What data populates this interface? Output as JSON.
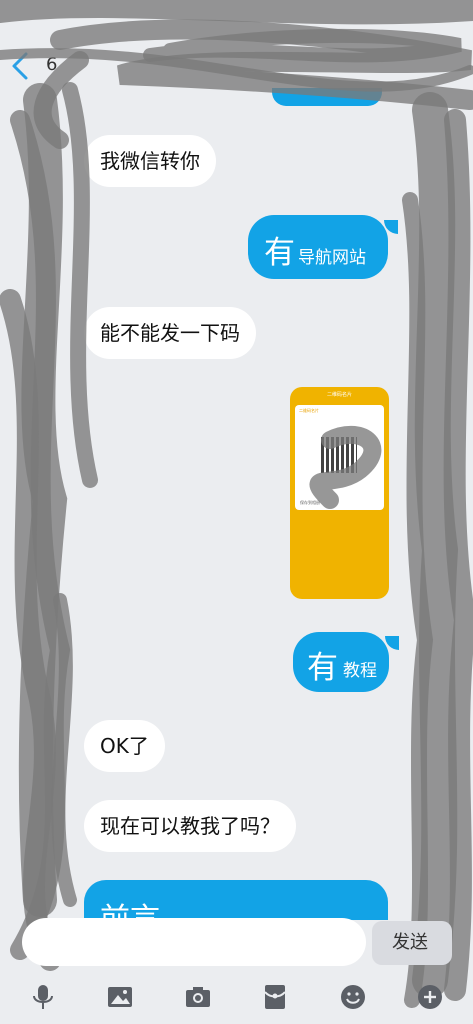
{
  "header": {
    "back_count": "6"
  },
  "messages": {
    "m1": "我微信转你",
    "m2_big": "有",
    "m2_small": "导航网站",
    "m3": "能不能发一下码",
    "m4_big": "有",
    "m4_small": "教程",
    "m5": "OK了",
    "m6": "现在可以教我了吗？",
    "m7_partial": "前言"
  },
  "image_message": {
    "header": "二维码名片",
    "card_title": "二维码名片",
    "footer": "保存到相册"
  },
  "composer": {
    "send_label": "发送"
  },
  "toolbar": {
    "icons": [
      "microphone-icon",
      "image-icon",
      "camera-icon",
      "red-packet-icon",
      "emoji-icon",
      "plus-icon"
    ]
  },
  "colors": {
    "outgoing_bubble": "#12a3e6",
    "background": "#ebedf0",
    "image_bg": "#f0b300"
  }
}
